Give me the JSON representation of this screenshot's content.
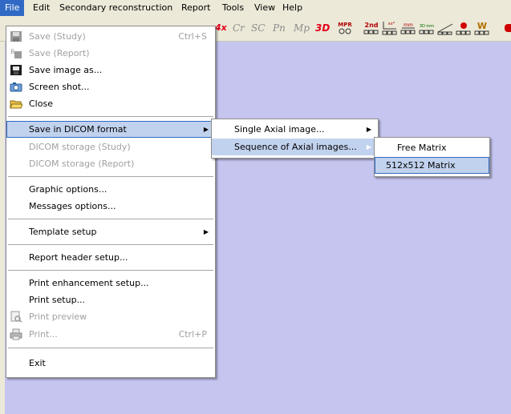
{
  "menubar": {
    "items": [
      {
        "label": "File"
      },
      {
        "label": "Edit"
      },
      {
        "label": "Secondary reconstruction"
      },
      {
        "label": "Report"
      },
      {
        "label": "Tools"
      },
      {
        "label": "View"
      },
      {
        "label": "Help"
      }
    ]
  },
  "toolbar": {
    "buttons": [
      {
        "label": "4x",
        "icon": "4x-icon"
      },
      {
        "label": "Cr"
      },
      {
        "label": "SC"
      },
      {
        "label": "Pn"
      },
      {
        "label": "Mp"
      },
      {
        "label": "3D"
      },
      {
        "icon": "mpr-icon",
        "label": "MPR"
      },
      {
        "icon": "2nd-icon",
        "label": "2nd"
      },
      {
        "icon": "xxx-chart-icon",
        "label": "xx*"
      },
      {
        "icon": "mm-grid-icon",
        "label": "mm"
      },
      {
        "icon": "3d-mm-icon",
        "label": "3D mm"
      },
      {
        "icon": "curve-icon"
      },
      {
        "icon": "red-dot-icon"
      },
      {
        "icon": "w-icon",
        "label": "W"
      }
    ]
  },
  "file_menu": {
    "items": [
      {
        "label": "Save (Study)",
        "shortcut": "Ctrl+S",
        "disabled": true,
        "icon": "save-disk-icon"
      },
      {
        "label": "Save (Report)",
        "disabled": true,
        "icon": "save-report-icon"
      },
      {
        "label": "Save image as...",
        "icon": "save-image-icon"
      },
      {
        "label": "Screen shot...",
        "icon": "camera-icon"
      },
      {
        "label": "Close",
        "icon": "open-folder-icon"
      },
      {
        "label": "Save in DICOM format",
        "submenu": true,
        "highlighted": true
      },
      {
        "label": "DICOM storage (Study)",
        "disabled": true
      },
      {
        "label": "DICOM storage (Report)",
        "disabled": true
      },
      {
        "label": "Graphic options..."
      },
      {
        "label": "Messages options..."
      },
      {
        "label": "Template setup",
        "submenu": true
      },
      {
        "label": "Report header setup..."
      },
      {
        "label": "Print enhancement setup..."
      },
      {
        "label": "Print setup..."
      },
      {
        "label": "Print preview",
        "disabled": true,
        "icon": "print-preview-icon"
      },
      {
        "label": "Print...",
        "shortcut": "Ctrl+P",
        "disabled": true,
        "icon": "printer-icon"
      },
      {
        "label": "Exit"
      }
    ]
  },
  "dicom_submenu": {
    "items": [
      {
        "label": "Single Axial image...",
        "submenu": true
      },
      {
        "label": "Sequence of Axial images...",
        "submenu": true,
        "highlighted": true
      }
    ]
  },
  "sequence_submenu": {
    "items": [
      {
        "label": "Free Matrix"
      },
      {
        "label": "512x512 Matrix",
        "highlighted": true
      }
    ]
  },
  "colors": {
    "menubar": "#ece9d8",
    "workspace": "#c5c5f0",
    "highlight": "#c1d2ee",
    "selection_border": "#316ac5",
    "active_menu": "#316ac5"
  }
}
